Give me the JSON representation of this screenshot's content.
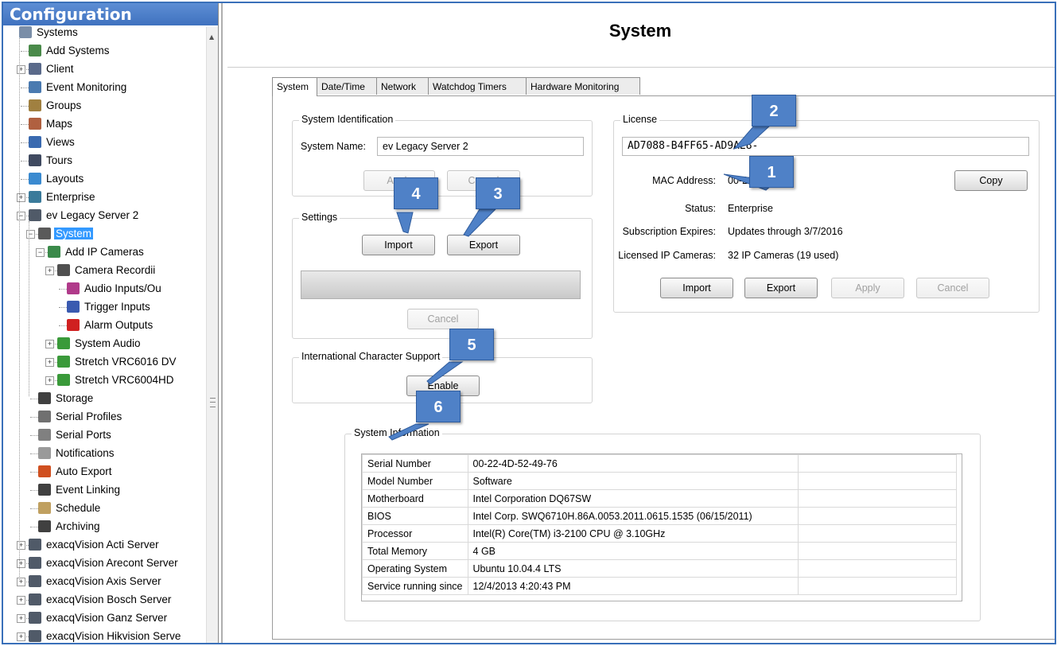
{
  "sidebar": {
    "header": "Configuration",
    "items": [
      {
        "label": "Systems",
        "icon": "server-list-icon",
        "color": "#7a8ea8"
      },
      {
        "label": "Add Systems",
        "icon": "add-system-icon",
        "color": "#4a8a4a"
      },
      {
        "label": "Client",
        "icon": "client-gear-icon",
        "color": "#5a6a8a"
      },
      {
        "label": "Event Monitoring",
        "icon": "event-monitoring-icon",
        "color": "#4a7ab0"
      },
      {
        "label": "Groups",
        "icon": "groups-icon",
        "color": "#a08040"
      },
      {
        "label": "Maps",
        "icon": "maps-icon",
        "color": "#b06040"
      },
      {
        "label": "Views",
        "icon": "views-icon",
        "color": "#3a6ab0"
      },
      {
        "label": "Tours",
        "icon": "tours-icon",
        "color": "#404a60"
      },
      {
        "label": "Layouts",
        "icon": "layouts-icon",
        "color": "#3a8ad0"
      },
      {
        "label": "Enterprise",
        "icon": "enterprise-icon",
        "color": "#3a7a9a"
      },
      {
        "label": "ev Legacy Server 2",
        "icon": "server-icon",
        "color": "#505a68"
      },
      {
        "label": "System",
        "icon": "system-icon",
        "color": "#5a5a5a"
      },
      {
        "label": "Add IP Cameras",
        "icon": "ip-camera-icon",
        "color": "#3a8a4a"
      },
      {
        "label": "Camera Recordii",
        "icon": "camera-recording-icon",
        "color": "#505050"
      },
      {
        "label": "Audio Inputs/Ou",
        "icon": "audio-icon",
        "color": "#b03a8a"
      },
      {
        "label": "Trigger Inputs",
        "icon": "trigger-input-icon",
        "color": "#3a5ab0"
      },
      {
        "label": "Alarm Outputs",
        "icon": "alarm-output-icon",
        "color": "#d02020"
      },
      {
        "label": "System Audio",
        "icon": "board-icon",
        "color": "#3a9a3a"
      },
      {
        "label": "Stretch VRC6016 DV",
        "icon": "board-icon",
        "color": "#3a9a3a"
      },
      {
        "label": "Stretch VRC6004HD",
        "icon": "board-icon",
        "color": "#3a9a3a"
      },
      {
        "label": "Storage",
        "icon": "storage-icon",
        "color": "#404040"
      },
      {
        "label": "Serial Profiles",
        "icon": "serial-profiles-icon",
        "color": "#707070"
      },
      {
        "label": "Serial Ports",
        "icon": "serial-ports-icon",
        "color": "#808080"
      },
      {
        "label": "Notifications",
        "icon": "envelope-icon",
        "color": "#9a9a9a"
      },
      {
        "label": "Auto Export",
        "icon": "auto-export-icon",
        "color": "#d05020"
      },
      {
        "label": "Event Linking",
        "icon": "event-linking-icon",
        "color": "#404040"
      },
      {
        "label": "Schedule",
        "icon": "schedule-icon",
        "color": "#c0a060"
      },
      {
        "label": "Archiving",
        "icon": "archiving-icon",
        "color": "#404040"
      },
      {
        "label": "exacqVision Acti Server",
        "icon": "server-icon",
        "color": "#505a68"
      },
      {
        "label": "exacqVision Arecont Server",
        "icon": "server-icon",
        "color": "#505a68"
      },
      {
        "label": "exacqVision Axis Server",
        "icon": "server-icon",
        "color": "#505a68"
      },
      {
        "label": "exacqVision Bosch Server",
        "icon": "server-icon",
        "color": "#505a68"
      },
      {
        "label": "exacqVision Ganz Server",
        "icon": "server-icon",
        "color": "#505a68"
      },
      {
        "label": "exacqVision Hikvision Serve",
        "icon": "server-icon",
        "color": "#505a68"
      }
    ]
  },
  "main": {
    "title": "System",
    "tabs": [
      "System",
      "Date/Time",
      "Network",
      "Watchdog Timers",
      "Hardware Monitoring"
    ],
    "system_identification": {
      "title": "System Identification",
      "name_label": "System Name:",
      "name_value": "ev Legacy Server 2",
      "apply": "Apply",
      "cancel": "Cancel"
    },
    "settings": {
      "title": "Settings",
      "import": "Import",
      "export": "Export",
      "cancel": "Cancel"
    },
    "intl": {
      "title": "International Character Support",
      "enable": "Enable"
    },
    "license": {
      "title": "License",
      "key": "AD7088-B4FF65-AD9AE8-",
      "mac_label": "MAC Address:",
      "mac_value": "00-22-4D-",
      "copy": "Copy",
      "status_label": "Status:",
      "status_value": "Enterprise",
      "subscription_label": "Subscription Expires:",
      "subscription_value": "Updates through 3/7/2016",
      "cameras_label": "Licensed IP Cameras:",
      "cameras_value": "32 IP Cameras (19 used)",
      "import": "Import",
      "export": "Export",
      "apply": "Apply",
      "cancel": "Cancel"
    },
    "system_information": {
      "title": "System Information",
      "rows": [
        {
          "k": "Serial Number",
          "v": "00-22-4D-52-49-76"
        },
        {
          "k": "Model Number",
          "v": "Software"
        },
        {
          "k": "Motherboard",
          "v": "Intel Corporation DQ67SW"
        },
        {
          "k": "BIOS",
          "v": "Intel Corp. SWQ6710H.86A.0053.2011.0615.1535 (06/15/2011)"
        },
        {
          "k": "Processor",
          "v": "Intel(R) Core(TM) i3-2100 CPU @ 3.10GHz"
        },
        {
          "k": "Total Memory",
          "v": "4 GB"
        },
        {
          "k": "Operating System",
          "v": "Ubuntu 10.04.4 LTS"
        },
        {
          "k": "Service running since",
          "v": "12/4/2013 4:20:43 PM"
        }
      ]
    },
    "callouts": [
      "1",
      "2",
      "3",
      "4",
      "5",
      "6"
    ]
  }
}
